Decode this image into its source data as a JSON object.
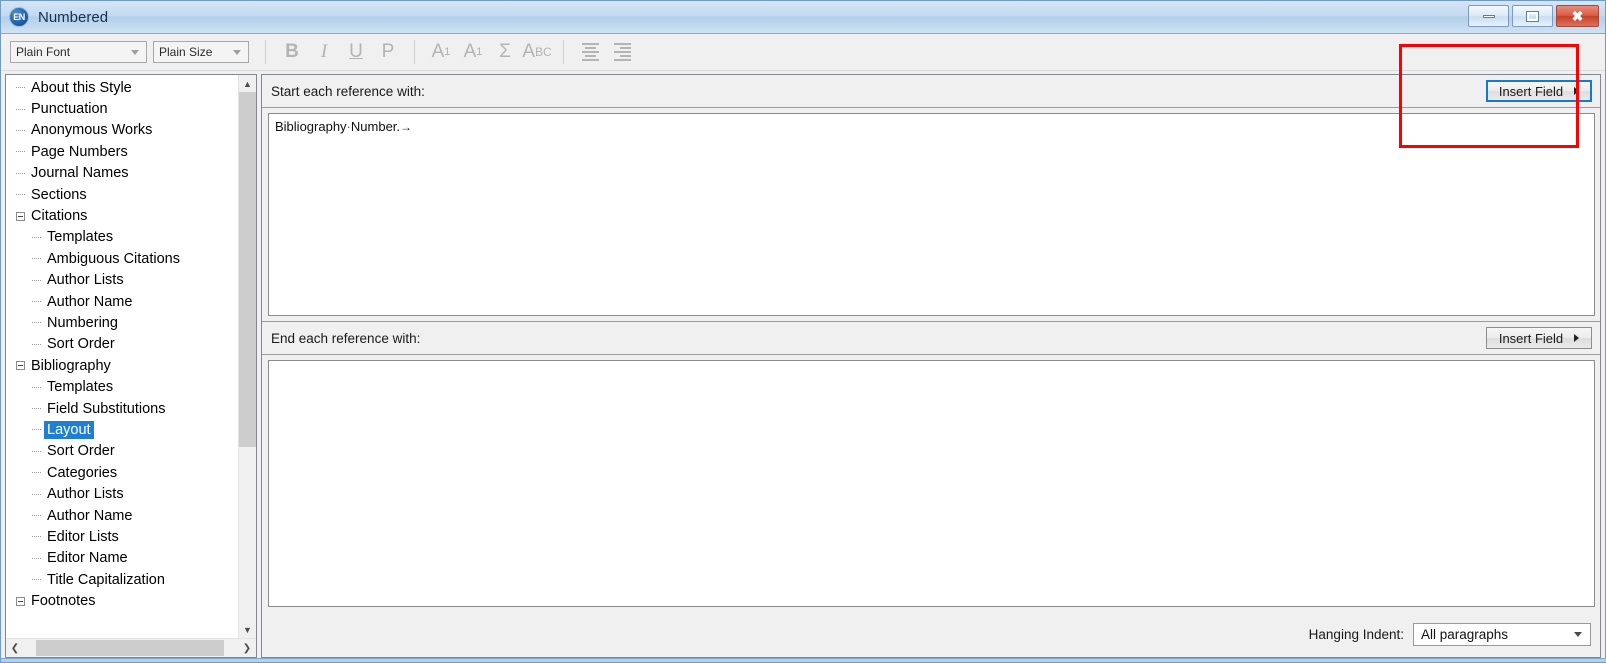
{
  "window": {
    "title": "Numbered",
    "app_icon": "endnote-en-icon",
    "controls": {
      "minimize": "minimize-icon",
      "restore": "restore-icon",
      "close": "close-icon"
    }
  },
  "toolbar": {
    "font_combo": {
      "value": "Plain Font",
      "icon": "chevron-down-icon"
    },
    "size_combo": {
      "value": "Plain Size",
      "icon": "chevron-down-icon"
    },
    "buttons": [
      {
        "name": "bold-button",
        "label": "B"
      },
      {
        "name": "italic-button",
        "label": "I"
      },
      {
        "name": "underline-button",
        "label": "U"
      },
      {
        "name": "plain-button",
        "label": "P"
      },
      {
        "name": "superscript-button",
        "label": "A1"
      },
      {
        "name": "subscript-button",
        "label": "A1"
      },
      {
        "name": "symbol-button",
        "label": "Σ"
      },
      {
        "name": "small-caps-button",
        "label": "ABC"
      },
      {
        "name": "align-left-button",
        "label": ""
      },
      {
        "name": "align-right-button",
        "label": ""
      }
    ]
  },
  "sidebar": {
    "selected": "Layout",
    "items": [
      {
        "label": "About this Style",
        "level": 0,
        "expandable": false
      },
      {
        "label": "Punctuation",
        "level": 0,
        "expandable": false
      },
      {
        "label": "Anonymous Works",
        "level": 0,
        "expandable": false
      },
      {
        "label": "Page Numbers",
        "level": 0,
        "expandable": false
      },
      {
        "label": "Journal Names",
        "level": 0,
        "expandable": false
      },
      {
        "label": "Sections",
        "level": 0,
        "expandable": false
      },
      {
        "label": "Citations",
        "level": 0,
        "expandable": true
      },
      {
        "label": "Templates",
        "level": 1,
        "expandable": false
      },
      {
        "label": "Ambiguous Citations",
        "level": 1,
        "expandable": false
      },
      {
        "label": "Author Lists",
        "level": 1,
        "expandable": false
      },
      {
        "label": "Author Name",
        "level": 1,
        "expandable": false
      },
      {
        "label": "Numbering",
        "level": 1,
        "expandable": false
      },
      {
        "label": "Sort Order",
        "level": 1,
        "expandable": false
      },
      {
        "label": "Bibliography",
        "level": 0,
        "expandable": true
      },
      {
        "label": "Templates",
        "level": 1,
        "expandable": false
      },
      {
        "label": "Field Substitutions",
        "level": 1,
        "expandable": false
      },
      {
        "label": "Layout",
        "level": 1,
        "expandable": false
      },
      {
        "label": "Sort Order",
        "level": 1,
        "expandable": false
      },
      {
        "label": "Categories",
        "level": 1,
        "expandable": false
      },
      {
        "label": "Author Lists",
        "level": 1,
        "expandable": false
      },
      {
        "label": "Author Name",
        "level": 1,
        "expandable": false
      },
      {
        "label": "Editor Lists",
        "level": 1,
        "expandable": false
      },
      {
        "label": "Editor Name",
        "level": 1,
        "expandable": false
      },
      {
        "label": "Title Capitalization",
        "level": 1,
        "expandable": false
      },
      {
        "label": "Footnotes",
        "level": 0,
        "expandable": true
      }
    ],
    "scroll_up_icon": "chevron-up-icon",
    "scroll_down_icon": "chevron-down-icon",
    "scroll_left_icon": "chevron-left-icon",
    "scroll_right_icon": "chevron-right-icon"
  },
  "main": {
    "start_section": {
      "label": "Start each reference with:",
      "insert_field_label": "Insert Field",
      "insert_field_icon": "caret-right-icon",
      "content_prefix": "Bibliography",
      "content_separator": "·",
      "content_suffix": "Number.",
      "content_tab_mark": "→"
    },
    "end_section": {
      "label": "End each reference with:",
      "insert_field_label": "Insert Field",
      "insert_field_icon": "caret-right-icon",
      "content": ""
    },
    "footer": {
      "hanging_indent_label": "Hanging Indent:",
      "hanging_indent_value": "All paragraphs",
      "hanging_indent_icon": "chevron-down-icon"
    }
  },
  "annotation": {
    "type": "highlight-rectangle",
    "color": "#fe0000",
    "target": "insert-field-button-start"
  }
}
